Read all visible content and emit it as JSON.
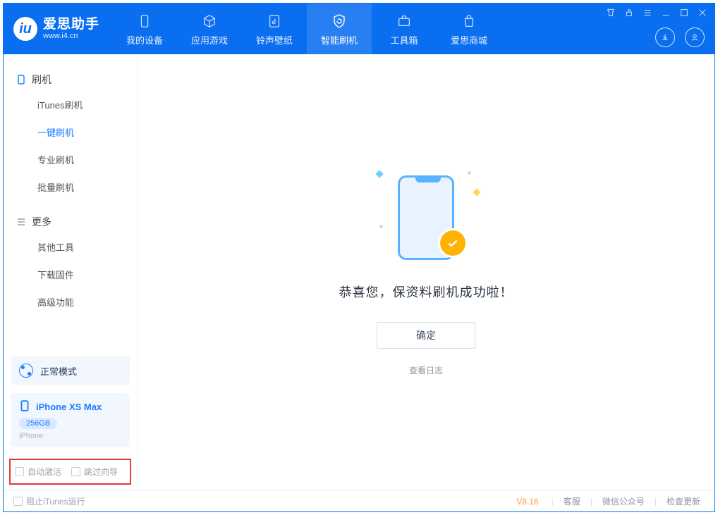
{
  "app": {
    "logo_main": "爱思助手",
    "logo_sub": "www.i4.cn"
  },
  "nav": {
    "tabs": [
      {
        "label": "我的设备"
      },
      {
        "label": "应用游戏"
      },
      {
        "label": "铃声壁纸"
      },
      {
        "label": "智能刷机"
      },
      {
        "label": "工具箱"
      },
      {
        "label": "爱思商城"
      }
    ]
  },
  "sidebar": {
    "group1_title": "刷机",
    "group1": [
      {
        "label": "iTunes刷机"
      },
      {
        "label": "一键刷机"
      },
      {
        "label": "专业刷机"
      },
      {
        "label": "批量刷机"
      }
    ],
    "group2_title": "更多",
    "group2": [
      {
        "label": "其他工具"
      },
      {
        "label": "下载固件"
      },
      {
        "label": "高级功能"
      }
    ]
  },
  "mode": {
    "label": "正常模式"
  },
  "device": {
    "name": "iPhone XS Max",
    "storage": "256GB",
    "type": "iPhone"
  },
  "options": {
    "auto_activate": "自动激活",
    "skip_guide": "跳过向导"
  },
  "main": {
    "success_text": "恭喜您，保资料刷机成功啦！",
    "ok": "确定",
    "view_log": "查看日志"
  },
  "status": {
    "block_itunes": "阻止iTunes运行",
    "version": "V8.16",
    "links": [
      "客服",
      "微信公众号",
      "检查更新"
    ]
  }
}
